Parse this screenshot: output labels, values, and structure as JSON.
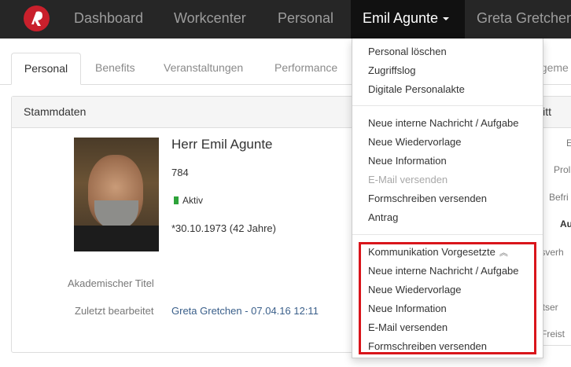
{
  "nav": {
    "items": [
      "Dashboard",
      "Workcenter",
      "Personal"
    ],
    "active_user": "Emil Agunte",
    "other_user": "Greta Gretchen"
  },
  "tabs": [
    "Personal",
    "Benefits",
    "Veranstaltungen",
    "Performance",
    "ageme"
  ],
  "panel": {
    "title": "Stammdaten",
    "salutation_name": "Herr Emil Agunte",
    "personnel_number": "784",
    "status": "Aktiv",
    "birth": "*30.10.1973 (42 Jahre)",
    "label_title": "Akademischer Titel",
    "label_last_edited": "Zuletzt bearbeitet",
    "last_edited": "Greta Gretchen - 07.04.16 12:11"
  },
  "panel2": {
    "title": "itt",
    "labels": [
      "E",
      "Prol",
      "Befri",
      "Au",
      "tsverh",
      "ntser",
      "Freist"
    ]
  },
  "dropdown": {
    "group1": [
      "Personal löschen",
      "Zugriffslog",
      "Digitale Personalakte"
    ],
    "group2": [
      "Neue interne Nachricht / Aufgabe",
      "Neue Wiedervorlage",
      "Neue Information",
      "E-Mail versenden",
      "Formschreiben versenden",
      "Antrag"
    ],
    "group3_header": "Kommunikation Vorgesetzte",
    "group3": [
      "Neue interne Nachricht / Aufgabe",
      "Neue Wiedervorlage",
      "Neue Information",
      "E-Mail versenden",
      "Formschreiben versenden"
    ]
  },
  "colors": {
    "nav_bg": "#262626",
    "brand_red": "#c9202c",
    "status_green": "#2ea33a",
    "highlight_red": "#d9151b",
    "link_blue": "#3a5f8a"
  }
}
